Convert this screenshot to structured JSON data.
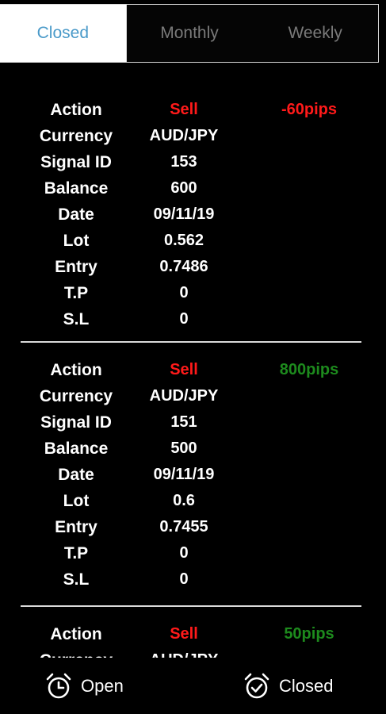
{
  "tabs": [
    "Closed",
    "Monthly",
    "Weekly"
  ],
  "labels": {
    "action": "Action",
    "currency": "Currency",
    "signal_id": "Signal ID",
    "balance": "Balance",
    "date": "Date",
    "lot": "Lot",
    "entry": "Entry",
    "tp": "T.P",
    "sl": "S.L"
  },
  "signals": [
    {
      "action": "Sell",
      "pips": "-60pips",
      "result": "loss",
      "currency": "AUD/JPY",
      "signal_id": "153",
      "balance": "600",
      "date": "09/11/19",
      "lot": "0.562",
      "entry": "0.7486",
      "tp": "0",
      "sl": "0"
    },
    {
      "action": "Sell",
      "pips": "800pips",
      "result": "win",
      "currency": "AUD/JPY",
      "signal_id": "151",
      "balance": "500",
      "date": "09/11/19",
      "lot": "0.6",
      "entry": "0.7455",
      "tp": "0",
      "sl": "0"
    },
    {
      "action": "Sell",
      "pips": "50pips",
      "result": "win",
      "currency": "AUD/JPY"
    }
  ],
  "bottom_nav": {
    "open_label": "Open",
    "closed_label": "Closed"
  },
  "colors": {
    "sell": "#ff1a1a",
    "loss": "#ff1a1a",
    "win": "#1d8a1d",
    "active_tab_text": "#4a9ac9"
  }
}
